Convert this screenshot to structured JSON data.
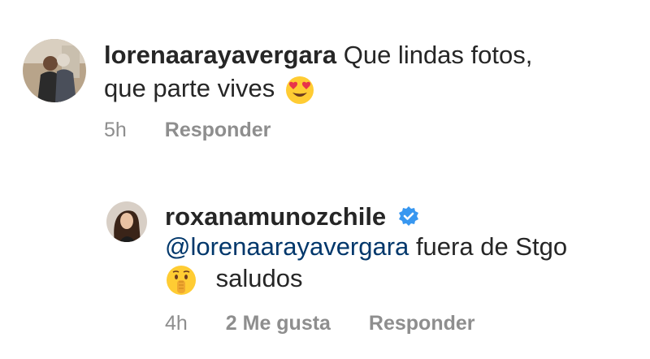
{
  "comment": {
    "username": "lorenaarayavergara",
    "text_line1": "Que lindas fotos,",
    "text_line2": "que parte vives",
    "emoji": "heart-eyes-emoji",
    "time": "5h",
    "reply_label": "Responder"
  },
  "reply": {
    "username": "roxanamunozchile",
    "verified": true,
    "mention": "@lorenaarayavergara",
    "text_line1": "fuera de Stgo",
    "text_line2": "saludos",
    "emoji": "shushing-face-emoji",
    "time": "4h",
    "likes_label": "2 Me gusta",
    "reply_label": "Responder"
  },
  "colors": {
    "text": "#262626",
    "secondary": "#8e8e8e",
    "mention": "#00376b",
    "verified": "#3897f0"
  }
}
